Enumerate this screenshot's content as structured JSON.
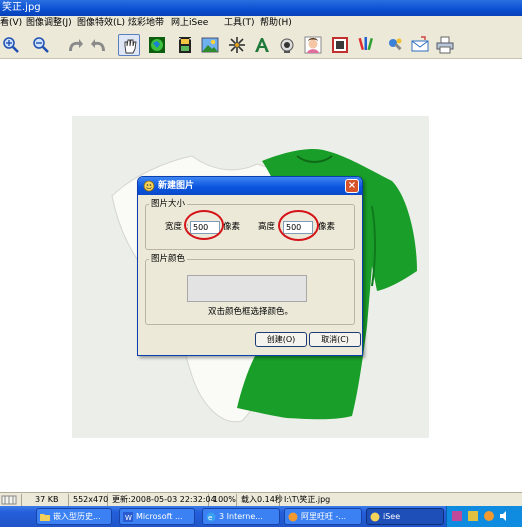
{
  "window": {
    "title": "笑正.jpg"
  },
  "menu": {
    "items": [
      "看(V)",
      "图像调整(J)",
      "图像特效(L)",
      "炫彩地带",
      "网上iSee",
      "工具(T)",
      "帮助(H)"
    ]
  },
  "toolbar": {
    "buttons": [
      "zoom-in-icon",
      "zoom-out-icon",
      "undo-icon",
      "redo-icon",
      "hand-icon",
      "globe-icon",
      "film-icon",
      "landscape-icon",
      "sparkle-icon",
      "text-icon",
      "camera-icon",
      "portrait-icon",
      "photo-frame-icon",
      "brush-icon",
      "tools-icon",
      "mail-icon",
      "printer-icon"
    ]
  },
  "dialog": {
    "title": "新建图片",
    "size_group": "图片大小",
    "width_label": "宽度",
    "width_value": "500",
    "width_unit": "像素",
    "height_label": "高度",
    "height_value": "500",
    "height_unit": "像素",
    "color_group": "图片颜色",
    "color_hint": "双击颜色框选择颜色。",
    "create_button": "创建(O)",
    "cancel_button": "取消(C)",
    "close_label": "×"
  },
  "statusbar": {
    "file_size": "37 KB",
    "dimensions": "552x470",
    "modified": "更新:2008-05-03 22:32:04",
    "zoom": "100%",
    "load_time": "载入0.14秒",
    "path": "I:\\T\\笑正.jpg"
  },
  "taskbar": {
    "items": [
      {
        "label": "嵌入型历史..."
      },
      {
        "label": "Microsoft ..."
      },
      {
        "label": "3 Interne..."
      },
      {
        "label": "阿里旺旺 -..."
      },
      {
        "label": "iSee"
      }
    ]
  },
  "colors": {
    "titlebar": "#0a4fd0",
    "dialog_bg": "#ece9d8",
    "red_marker": "#d41418",
    "green_shirt": "#1a9e2a"
  }
}
